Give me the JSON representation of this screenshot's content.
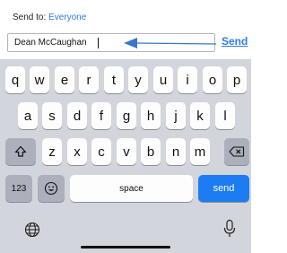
{
  "header": {
    "send_to_label": "Send to:",
    "send_to_value": "Everyone"
  },
  "message": {
    "text": "Dean McCaughan",
    "send_link": "Send"
  },
  "keyboard": {
    "row1": [
      "q",
      "w",
      "e",
      "r",
      "t",
      "y",
      "u",
      "i",
      "o",
      "p"
    ],
    "row2": [
      "a",
      "s",
      "d",
      "f",
      "g",
      "h",
      "j",
      "k",
      "l"
    ],
    "row3": [
      "z",
      "x",
      "c",
      "v",
      "b",
      "n",
      "m"
    ],
    "numbers_label": "123",
    "space_label": "space",
    "send_label": "send"
  },
  "colors": {
    "accent": "#2f7be8",
    "send_key": "#1d7cf2",
    "keyboard_bg": "#d3d5dc"
  }
}
